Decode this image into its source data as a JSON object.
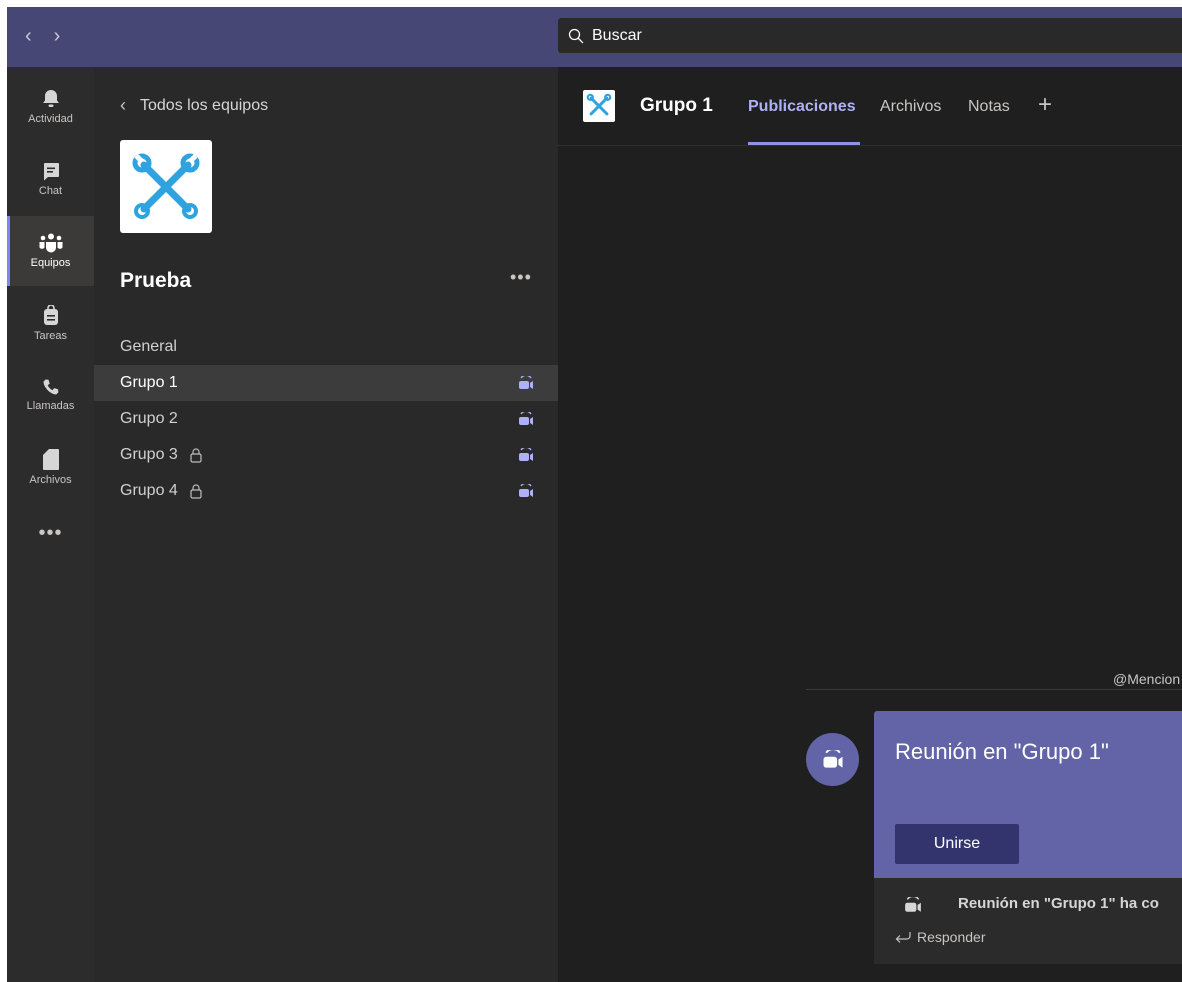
{
  "topbar": {
    "back_glyph": "‹",
    "forward_glyph": "›",
    "search_placeholder": "Buscar",
    "search_icon": "search-icon"
  },
  "rail": {
    "items": [
      {
        "label": "Actividad",
        "icon": "bell-icon"
      },
      {
        "label": "Chat",
        "icon": "chat-icon"
      },
      {
        "label": "Equipos",
        "icon": "teams-icon",
        "active": true
      },
      {
        "label": "Tareas",
        "icon": "tasks-icon"
      },
      {
        "label": "Llamadas",
        "icon": "phone-icon"
      },
      {
        "label": "Archivos",
        "icon": "file-icon"
      }
    ],
    "more": "•••"
  },
  "team_panel": {
    "back_label": "Todos los equipos",
    "team_name": "Prueba",
    "team_more": "•••",
    "channels": [
      {
        "name": "General",
        "locked": false,
        "meeting": false
      },
      {
        "name": "Grupo 1",
        "locked": false,
        "meeting": true,
        "active": true
      },
      {
        "name": "Grupo 2",
        "locked": false,
        "meeting": true
      },
      {
        "name": "Grupo 3",
        "locked": true,
        "meeting": true
      },
      {
        "name": "Grupo 4",
        "locked": true,
        "meeting": true
      }
    ]
  },
  "main": {
    "channel_title": "Grupo 1",
    "tabs": [
      {
        "label": "Publicaciones",
        "active": true
      },
      {
        "label": "Archivos"
      },
      {
        "label": "Notas"
      }
    ],
    "add_tab": "+",
    "mention": "@Mencion",
    "meeting_card": {
      "title": "Reunión en \"Grupo 1\"",
      "join_label": "Unirse",
      "ended_text": "Reunión en \"Grupo 1\" ha co",
      "reply_label": "Responder"
    }
  },
  "colors": {
    "topbar": "#464775",
    "accent": "#6264a7",
    "active_tab": "#aeb1f5",
    "rail": "#2d2c2c",
    "panel": "#292929",
    "main": "#1f1f1f"
  }
}
